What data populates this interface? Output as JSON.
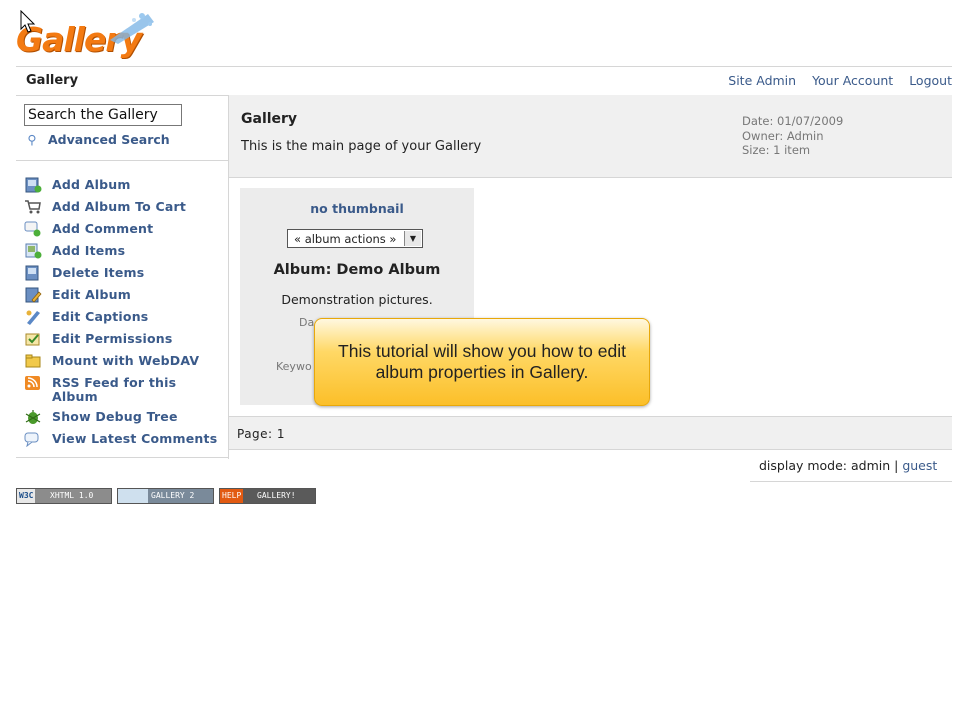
{
  "logo": {
    "text": "Gallery"
  },
  "header": {
    "title": "Gallery",
    "links": [
      "Site Admin",
      "Your Account",
      "Logout"
    ]
  },
  "sidebar": {
    "search_value": "Search the Gallery",
    "advanced_search": "Advanced Search",
    "items": [
      {
        "label": "Add Album",
        "icon": "add-album-icon"
      },
      {
        "label": "Add Album To Cart",
        "icon": "cart-icon"
      },
      {
        "label": "Add Comment",
        "icon": "comment-add-icon"
      },
      {
        "label": "Add Items",
        "icon": "add-items-icon"
      },
      {
        "label": "Delete Items",
        "icon": "delete-icon"
      },
      {
        "label": "Edit Album",
        "icon": "edit-album-icon"
      },
      {
        "label": "Edit Captions",
        "icon": "captions-icon"
      },
      {
        "label": "Edit Permissions",
        "icon": "permissions-icon"
      },
      {
        "label": "Mount with WebDAV",
        "icon": "webdav-icon"
      },
      {
        "label": "RSS Feed for this Album",
        "icon": "rss-icon"
      },
      {
        "label": "Show Debug Tree",
        "icon": "bug-icon"
      },
      {
        "label": "View Latest Comments",
        "icon": "comments-icon"
      }
    ]
  },
  "main": {
    "title": "Gallery",
    "description": "This is the main page of your Gallery",
    "meta": {
      "date": "Date: 01/07/2009",
      "owner": "Owner: Admin",
      "size": "Size: 1 item"
    }
  },
  "album": {
    "thumbnail_text": "no thumbnail",
    "actions_value": "« album actions »",
    "title": "Album: Demo Album",
    "description": "Demonstration pictures.",
    "date_fragment": "Da",
    "keywords_fragment": "Keywo"
  },
  "pager": {
    "text": "Page: 1"
  },
  "display_mode": {
    "label": "display mode: admin |",
    "guest": "guest"
  },
  "badges": [
    {
      "left": "W3C",
      "right": "XHTML 1.0"
    },
    {
      "left": "",
      "right": "GALLERY 2"
    },
    {
      "left": "HELP",
      "right": "GALLERY!"
    }
  ],
  "tooltip": {
    "text": "This tutorial will show you how to edit album properties in Gallery."
  },
  "colors": {
    "link": "#3a5a8a",
    "logo_orange": "#f37a12",
    "tooltip_yellow": "#fbbf29"
  }
}
